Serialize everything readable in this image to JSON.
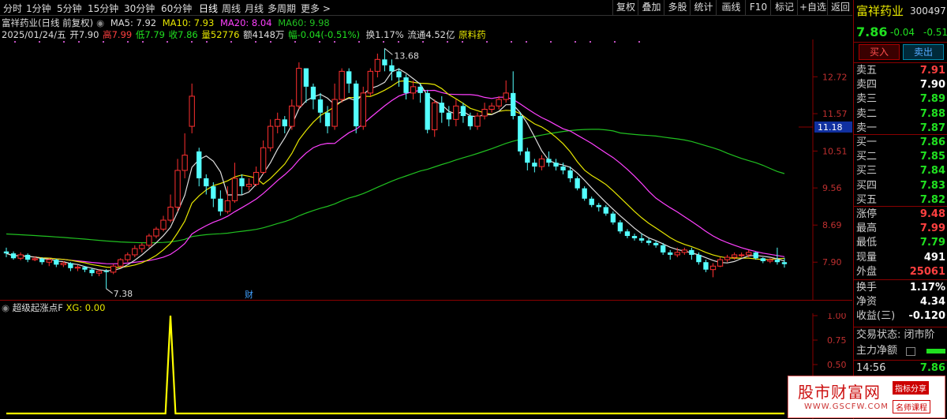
{
  "toolbar": {
    "periods": [
      "分时",
      "1分钟",
      "5分钟",
      "15分钟",
      "30分钟",
      "60分钟",
      "日线",
      "周线",
      "月线",
      "多周期",
      "更多 >"
    ],
    "active_period": "日线",
    "right_buttons": [
      "复权",
      "叠加",
      "多股",
      "统计",
      "画线",
      "F10",
      "标记",
      "+自选",
      "返回"
    ]
  },
  "info": {
    "title": "富祥药业(日线 前复权)",
    "ma5": "MA5: 7.92",
    "ma10": "MA10: 7.93",
    "ma20": "MA20: 8.04",
    "ma60": "MA60: 9.98",
    "date": "2025/01/24/五",
    "open": "开7.90",
    "high": "高7.99",
    "low": "低7.79",
    "close": "收7.86",
    "volume": "量52776",
    "amount": "额4148万",
    "change": "幅-0.04(-0.51%)",
    "turnover": "换1.17%",
    "float": "流通4.52亿",
    "sector": "原料药"
  },
  "chart_data": {
    "type": "candlestick",
    "y_ticks": [
      "12.72",
      "11.57",
      "10.51",
      "9.56",
      "8.69",
      "7.90"
    ],
    "current_price_label": "11.18",
    "high_label": "13.68",
    "low_label": "7.38",
    "event_marker": "财",
    "ohlc": [
      [
        8.12,
        8.08,
        8.2,
        8.0
      ],
      [
        8.08,
        7.98,
        8.12,
        7.95
      ],
      [
        7.98,
        8.05,
        8.1,
        7.94
      ],
      [
        8.05,
        7.95,
        8.08,
        7.9
      ],
      [
        7.95,
        7.97,
        8.02,
        7.92
      ],
      [
        7.97,
        7.9,
        8.0,
        7.85
      ],
      [
        7.9,
        7.95,
        7.98,
        7.82
      ],
      [
        7.95,
        7.85,
        7.97,
        7.8
      ],
      [
        7.85,
        7.88,
        7.92,
        7.8
      ],
      [
        7.88,
        7.78,
        7.9,
        7.72
      ],
      [
        7.78,
        7.8,
        7.84,
        7.72
      ],
      [
        7.8,
        7.75,
        7.82,
        7.7
      ],
      [
        7.75,
        7.68,
        7.78,
        7.62
      ],
      [
        7.68,
        7.72,
        7.75,
        7.62
      ],
      [
        7.72,
        7.7,
        7.76,
        7.38
      ],
      [
        7.7,
        7.82,
        7.86,
        7.66
      ],
      [
        7.82,
        7.95,
        7.98,
        7.78
      ],
      [
        7.95,
        8.05,
        8.1,
        7.9
      ],
      [
        8.05,
        8.18,
        8.25,
        8.0
      ],
      [
        8.18,
        8.25,
        8.3,
        8.1
      ],
      [
        8.25,
        8.45,
        8.5,
        8.2
      ],
      [
        8.45,
        8.6,
        8.65,
        8.4
      ],
      [
        8.6,
        8.8,
        8.9,
        8.55
      ],
      [
        8.8,
        9.1,
        9.4,
        8.75
      ],
      [
        9.1,
        10.0,
        10.3,
        9.0
      ],
      [
        10.0,
        10.4,
        11.0,
        9.8
      ],
      [
        11.2,
        12.1,
        12.5,
        11.0
      ],
      [
        10.5,
        9.8,
        10.6,
        9.6
      ],
      [
        9.8,
        9.6,
        9.9,
        9.4
      ],
      [
        9.6,
        9.3,
        9.7,
        9.1
      ],
      [
        9.3,
        9.0,
        9.5,
        8.9
      ],
      [
        9.0,
        9.25,
        9.6,
        8.95
      ],
      [
        9.25,
        9.8,
        10.2,
        9.2
      ],
      [
        9.8,
        9.6,
        9.9,
        9.4
      ],
      [
        9.6,
        9.65,
        9.8,
        9.5
      ],
      [
        9.65,
        9.95,
        10.1,
        9.6
      ],
      [
        9.95,
        10.6,
        10.8,
        9.9
      ],
      [
        10.6,
        11.2,
        11.4,
        10.5
      ],
      [
        11.2,
        11.4,
        11.6,
        11.0
      ],
      [
        11.4,
        11.2,
        11.5,
        11.0
      ],
      [
        11.2,
        11.8,
        12.0,
        11.1
      ],
      [
        11.8,
        13.0,
        13.2,
        11.7
      ],
      [
        13.0,
        12.4,
        13.0,
        11.9
      ],
      [
        12.4,
        12.0,
        12.5,
        11.7
      ],
      [
        12.0,
        11.6,
        12.2,
        11.3
      ],
      [
        11.6,
        11.2,
        11.8,
        11.0
      ],
      [
        11.2,
        12.0,
        12.5,
        11.1
      ],
      [
        12.0,
        12.9,
        13.0,
        11.9
      ],
      [
        12.9,
        12.5,
        13.0,
        12.2
      ],
      [
        12.5,
        11.2,
        12.6,
        11.0
      ],
      [
        11.2,
        12.2,
        12.4,
        11.1
      ],
      [
        12.2,
        12.9,
        13.0,
        12.1
      ],
      [
        12.9,
        13.3,
        13.5,
        12.7
      ],
      [
        13.3,
        13.1,
        13.68,
        12.9
      ],
      [
        13.1,
        12.9,
        13.3,
        12.6
      ],
      [
        12.9,
        12.7,
        13.0,
        12.4
      ],
      [
        12.7,
        12.2,
        12.8,
        12.0
      ],
      [
        12.2,
        12.4,
        12.6,
        12.0
      ],
      [
        12.4,
        12.2,
        12.5,
        11.9
      ],
      [
        12.2,
        11.1,
        12.3,
        11.0
      ],
      [
        11.1,
        11.9,
        12.0,
        10.9
      ],
      [
        11.9,
        11.6,
        12.1,
        11.3
      ],
      [
        11.6,
        11.4,
        11.8,
        11.2
      ],
      [
        11.4,
        11.8,
        12.0,
        11.2
      ],
      [
        11.8,
        11.5,
        11.9,
        11.3
      ],
      [
        11.5,
        11.2,
        11.6,
        11.1
      ],
      [
        11.2,
        11.5,
        11.6,
        11.1
      ],
      [
        11.5,
        11.7,
        11.9,
        11.4
      ],
      [
        11.7,
        11.8,
        11.9,
        11.6
      ],
      [
        11.8,
        12.0,
        12.1,
        11.7
      ],
      [
        12.0,
        12.2,
        12.6,
        11.9
      ],
      [
        12.2,
        11.5,
        12.9,
        11.4
      ],
      [
        11.5,
        10.5,
        11.6,
        10.4
      ],
      [
        10.5,
        10.2,
        10.6,
        10.0
      ],
      [
        10.2,
        10.1,
        10.3,
        9.95
      ],
      [
        10.1,
        10.3,
        10.4,
        10.0
      ],
      [
        10.3,
        10.2,
        10.5,
        10.1
      ],
      [
        10.2,
        10.1,
        10.3,
        10.0
      ],
      [
        10.1,
        10.0,
        10.2,
        9.9
      ],
      [
        10.0,
        9.8,
        10.1,
        9.7
      ],
      [
        9.8,
        9.55,
        9.85,
        9.5
      ],
      [
        9.55,
        9.3,
        9.6,
        9.25
      ],
      [
        9.3,
        9.15,
        9.35,
        9.1
      ],
      [
        9.15,
        9.1,
        9.2,
        9.0
      ],
      [
        9.1,
        8.95,
        9.15,
        8.9
      ],
      [
        8.95,
        8.75,
        9.0,
        8.7
      ],
      [
        8.75,
        8.55,
        8.8,
        8.5
      ],
      [
        8.55,
        8.45,
        8.6,
        8.4
      ],
      [
        8.45,
        8.4,
        8.5,
        8.35
      ],
      [
        8.4,
        8.35,
        8.5,
        8.3
      ],
      [
        8.35,
        8.3,
        8.4,
        8.25
      ],
      [
        8.3,
        8.25,
        8.35,
        8.2
      ],
      [
        8.25,
        8.1,
        8.3,
        8.05
      ],
      [
        8.1,
        8.05,
        8.15,
        7.95
      ],
      [
        8.05,
        8.1,
        8.2,
        8.0
      ],
      [
        8.1,
        8.15,
        8.2,
        8.05
      ],
      [
        8.15,
        8.05,
        8.2,
        7.95
      ],
      [
        8.05,
        7.9,
        8.1,
        7.85
      ],
      [
        7.9,
        7.75,
        7.95,
        7.7
      ],
      [
        7.75,
        7.82,
        7.88,
        7.6
      ],
      [
        7.82,
        7.95,
        8.0,
        7.8
      ],
      [
        7.95,
        8.0,
        8.05,
        7.9
      ],
      [
        8.0,
        8.05,
        8.1,
        7.95
      ],
      [
        8.05,
        8.05,
        8.1,
        8.0
      ],
      [
        8.05,
        8.1,
        8.15,
        8.0
      ],
      [
        8.1,
        7.98,
        8.12,
        7.95
      ],
      [
        7.98,
        7.92,
        8.0,
        7.88
      ],
      [
        7.92,
        7.95,
        7.98,
        7.88
      ],
      [
        7.95,
        7.9,
        8.2,
        7.85
      ],
      [
        7.9,
        7.86,
        7.99,
        7.79
      ]
    ],
    "sub_indicator": {
      "title": "超级起涨点F",
      "label": "XG: 0.00",
      "y_ticks": [
        "1.00",
        "0.75",
        "0.50"
      ],
      "signal_index": 23
    }
  },
  "right_panel": {
    "name": "富祥药业",
    "code": "300497",
    "price": "7.86",
    "change": "-0.04",
    "pct": "-0.51",
    "buy_btn": "买入",
    "sell_btn": "卖出",
    "asks": [
      [
        "卖五",
        "7.91"
      ],
      [
        "卖四",
        "7.90"
      ],
      [
        "卖三",
        "7.89"
      ],
      [
        "卖二",
        "7.88"
      ],
      [
        "卖一",
        "7.87"
      ]
    ],
    "bids": [
      [
        "买一",
        "7.86"
      ],
      [
        "买二",
        "7.85"
      ],
      [
        "买三",
        "7.84"
      ],
      [
        "买四",
        "7.83"
      ],
      [
        "买五",
        "7.82"
      ]
    ],
    "stats1": [
      [
        "涨停",
        "9.48"
      ],
      [
        "最高",
        "7.99"
      ],
      [
        "最低",
        "7.79"
      ],
      [
        "现量",
        "491"
      ],
      [
        "外盘",
        "25061"
      ]
    ],
    "stats2": [
      [
        "换手",
        "1.17%"
      ],
      [
        "净资",
        "4.34"
      ],
      [
        "收益(三)",
        "-0.120"
      ]
    ],
    "status": "交易状态: 闭市阶",
    "main_flow": "主力净额",
    "time": "14:56",
    "time_price": "7.86"
  },
  "watermark": {
    "title": "股市财富网",
    "tag1": "指标分享",
    "tag2": "名师课程",
    "url": "WWW.GSCFW.COM"
  },
  "colors": {
    "up": "#ff3030",
    "down": "#54ffff",
    "ma5": "#dddddd",
    "ma10": "#e6e600",
    "ma20": "#ff40ff",
    "ma60": "#20c020"
  }
}
